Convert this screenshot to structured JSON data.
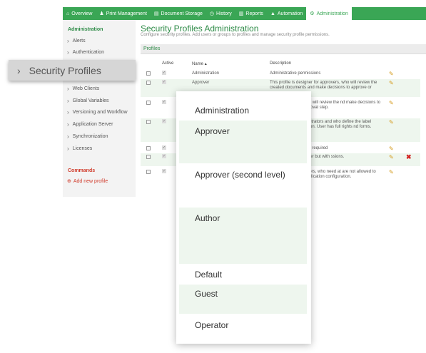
{
  "topnav": {
    "items": [
      {
        "label": "Overview",
        "icon": "home-icon"
      },
      {
        "label": "Print Management",
        "icon": "people-icon"
      },
      {
        "label": "Document Storage",
        "icon": "printer-icon"
      },
      {
        "label": "History",
        "icon": "history-icon"
      },
      {
        "label": "Reports",
        "icon": "chart-icon"
      },
      {
        "label": "Automation",
        "icon": "automation-icon"
      },
      {
        "label": "Administration",
        "icon": "admin-icon",
        "active": true
      }
    ]
  },
  "sidebar": {
    "section_title": "Administration",
    "items": [
      "Alerts",
      "Authentication",
      "Web Clients",
      "Global Variables",
      "Versioning and Workflow",
      "Application Server",
      "Synchronization",
      "Licenses"
    ],
    "commands_title": "Commands",
    "command": "Add new profile",
    "zoomed_item": "Security Profiles"
  },
  "main": {
    "title": "Security Profiles Administration",
    "subtitle": "Configure security profiles. Add users or groups to profiles and manage security profile permissions.",
    "section": "Profiles"
  },
  "table": {
    "headers": {
      "active": "Active",
      "name": "Name",
      "description": "Description"
    },
    "rows": [
      {
        "name": "Administration",
        "desc": "Administrative permissions"
      },
      {
        "name": "Approver",
        "desc": "This profile is designer for approvers, who will review the created documents and make decisions to approve or"
      },
      {
        "name": "",
        "desc": "ed for approvers, who will review the nd make decisions to approve or cond approval step."
      },
      {
        "name": "",
        "desc": "ed for system administrators and who define the label templates or production. User has full rights nd forms."
      },
      {
        "name": "",
        "desc": "used when no login is required"
      },
      {
        "name": "",
        "desc": "ing in to Control Center but with ssions."
      },
      {
        "name": "",
        "desc": "ed for printing operators, who need at are not allowed to change the of the application configuration."
      }
    ]
  },
  "dropdown": {
    "items": [
      "Administration",
      "Approver",
      "Approver (second level)",
      "Author",
      "Default",
      "Guest",
      "Operator"
    ]
  }
}
